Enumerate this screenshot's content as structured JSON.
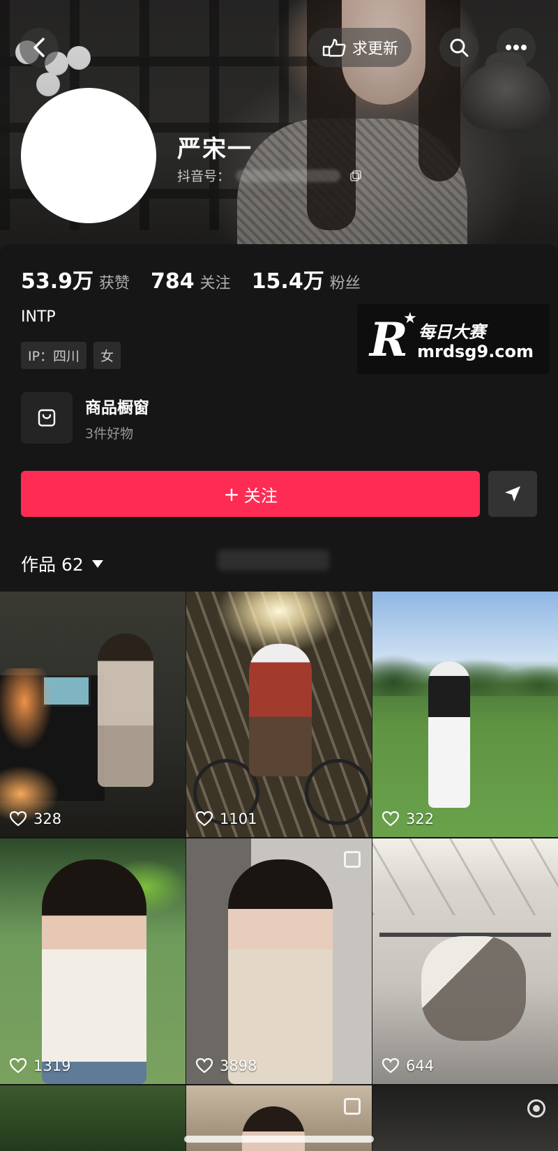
{
  "header": {
    "update_label": "求更新"
  },
  "profile": {
    "name": "严宋一",
    "douyin_id_label": "抖音号：",
    "stats": [
      {
        "value": "53.9万",
        "label": "获赞"
      },
      {
        "value": "784",
        "label": "关注"
      },
      {
        "value": "15.4万",
        "label": "粉丝"
      }
    ],
    "bio": "INTP",
    "tags": [
      "IP：四川",
      "女"
    ]
  },
  "watermark": {
    "logo_letter": "R",
    "star": "★",
    "cn_text": "每日大赛",
    "url": "mrdsg9.com"
  },
  "shop": {
    "title": "商品橱窗",
    "subtitle": "3件好物"
  },
  "actions": {
    "follow_label": "关注",
    "follow_plus": "+"
  },
  "works": {
    "label": "作品 62"
  },
  "grid": [
    {
      "likes": "328"
    },
    {
      "likes": "1101"
    },
    {
      "likes": "322"
    },
    {
      "likes": "1319"
    },
    {
      "likes": "3898"
    },
    {
      "likes": "644"
    }
  ],
  "colors": {
    "accent": "#fe2c55",
    "background": "#161616"
  },
  "icons": [
    "back-icon",
    "pointing-hand-icon",
    "search-icon",
    "more-icon",
    "copy-icon",
    "bag-icon",
    "share-icon",
    "caret-down-icon",
    "heart-icon",
    "multi-image-icon",
    "live-icon"
  ]
}
